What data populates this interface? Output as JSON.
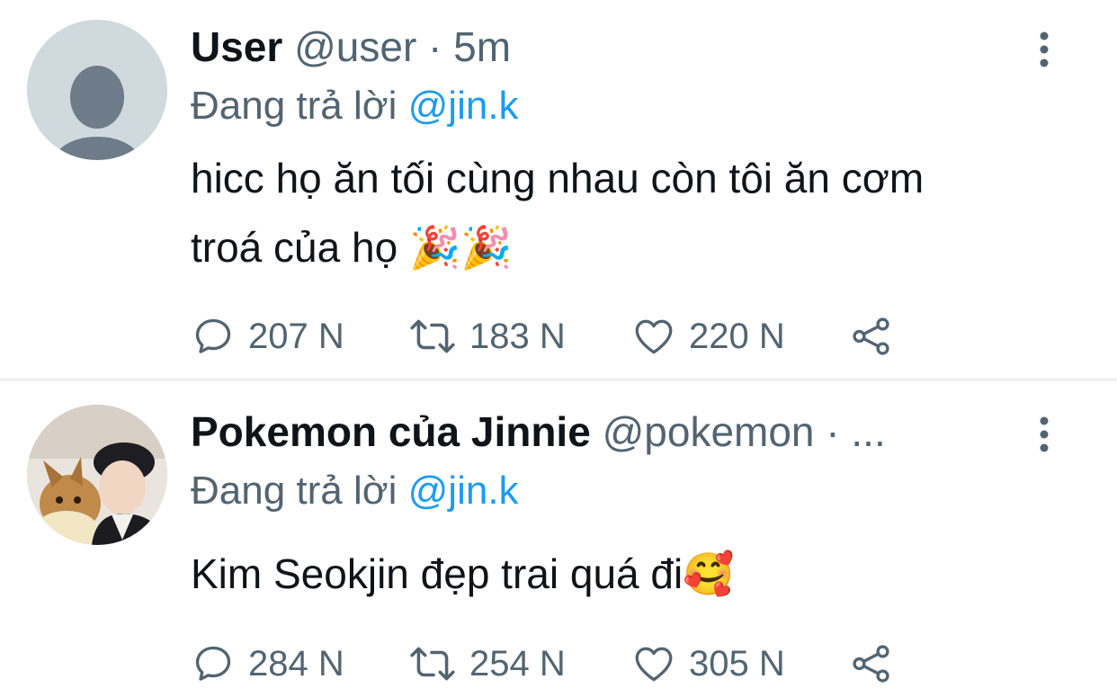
{
  "tweets": [
    {
      "display_name": "User",
      "handle": "@user",
      "separator": "·",
      "time": "5m",
      "reply_prefix": "Đang trả lời",
      "reply_to": "@jin.k",
      "text": "hicc họ ăn tối cùng nhau còn tôi ăn cơm troá của họ 🎉🎉",
      "replies": "207 N",
      "retweets": "183 N",
      "likes": "220 N",
      "avatar_icon": "default-user-icon"
    },
    {
      "display_name": "Pokemon của Jinnie",
      "handle": "@pokemon",
      "separator": "·",
      "time": "...",
      "reply_prefix": "Đang trả lời",
      "reply_to": "@jin.k",
      "text": "Kim Seokjin đẹp trai quá đi🥰",
      "replies": "284 N",
      "retweets": "254 N",
      "likes": "305 N",
      "avatar_icon": "profile-photo"
    }
  ],
  "icons": {
    "reply": "reply-icon",
    "retweet": "retweet-icon",
    "like": "heart-icon",
    "share": "share-icon",
    "more": "more-vertical-icon"
  },
  "colors": {
    "text": "#0f1419",
    "secondary": "#536471",
    "link": "#1d9bf0",
    "divider": "#eff3f4"
  }
}
